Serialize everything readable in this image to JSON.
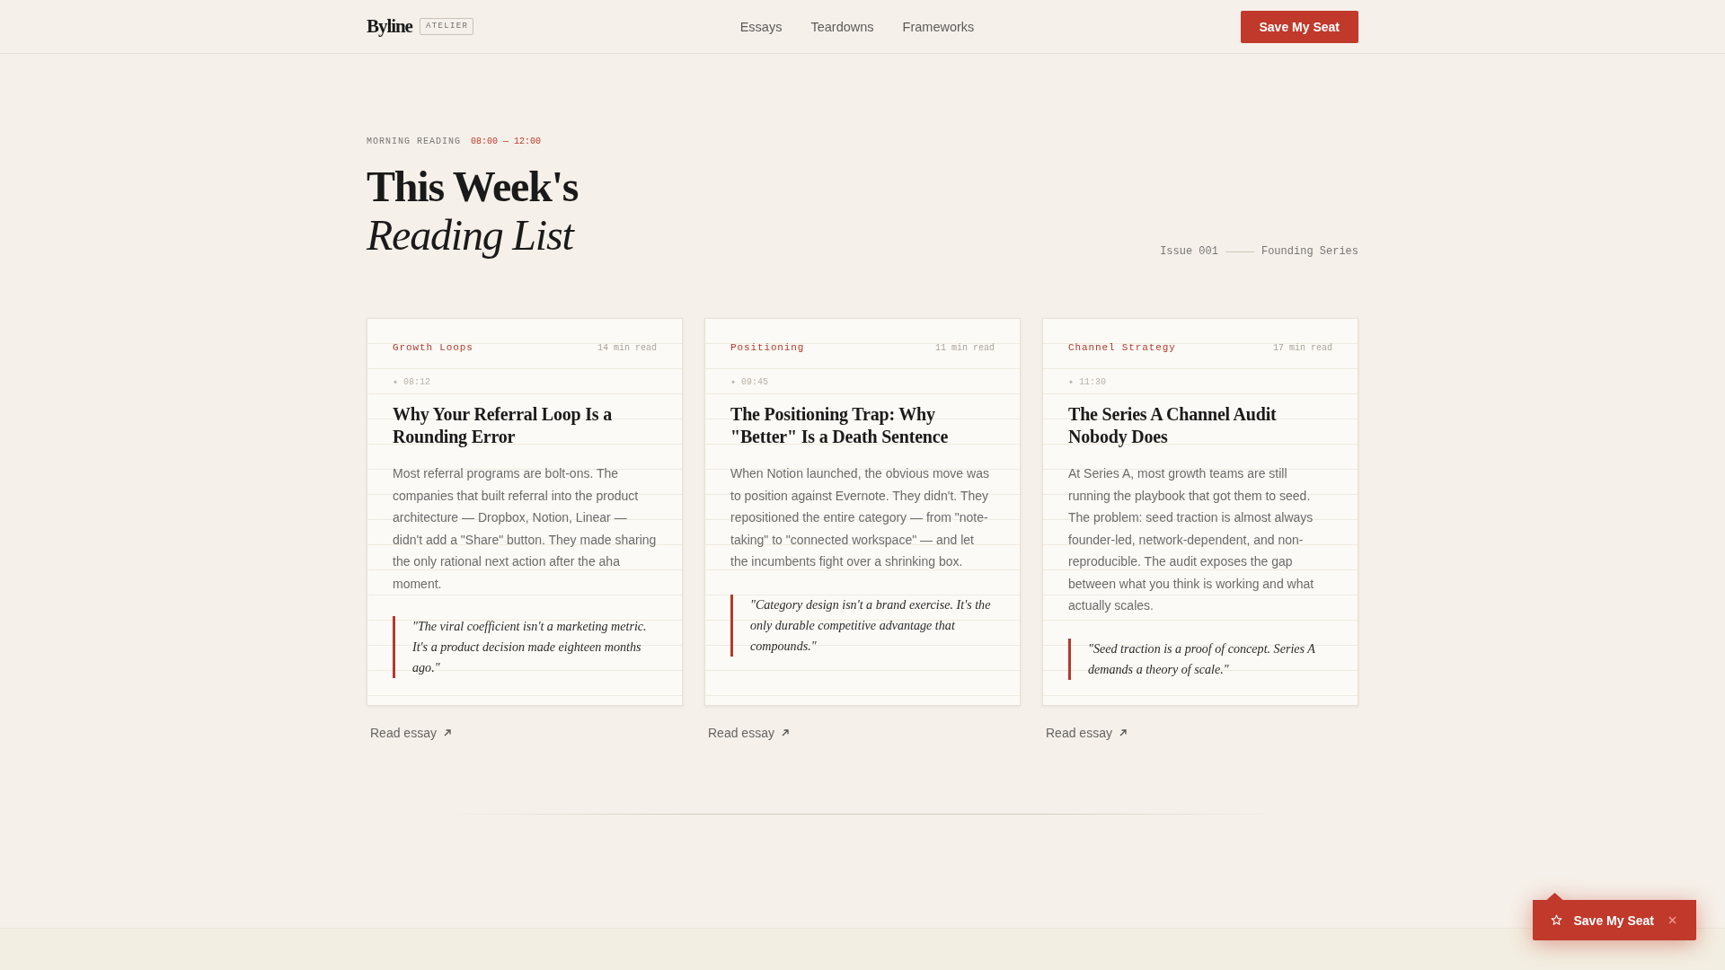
{
  "header": {
    "logo": "Byline",
    "brand_tag": "ATELIER",
    "nav": [
      {
        "label": "Essays"
      },
      {
        "label": "Teardowns"
      },
      {
        "label": "Frameworks"
      }
    ],
    "cta": "Save My Seat"
  },
  "hero": {
    "eyebrow": "MORNING READING",
    "time_range": "08:00 — 12:00",
    "title_lines": [
      {
        "text": "This Week's",
        "kind": "bold"
      },
      {
        "text": "Reading List",
        "kind": "italic"
      }
    ],
    "issue": "Issue 001",
    "series": "Founding Series"
  },
  "essays": [
    {
      "category": "Growth Loops",
      "read_time": "14 min read",
      "timestamp": "✦ 08:12",
      "title": "Why Your Referral Loop Is a Rounding Error",
      "excerpt": "Most referral programs are bolt-ons. The companies that built referral into the product architecture — Dropbox, Notion, Linear — didn't add a \"Share\" button. They made sharing the only rational next action after the aha moment.",
      "quote": "\"The viral coefficient isn't a marketing metric. It's a product decision made eighteen months ago.\"",
      "link": "Read essay"
    },
    {
      "category": "Positioning",
      "read_time": "11 min read",
      "timestamp": "✦ 09:45",
      "title": "The Positioning Trap: Why \"Better\" Is a Death Sentence",
      "excerpt": "When Notion launched, the obvious move was to position against Evernote. They didn't. They repositioned the entire category — from \"note-taking\" to \"connected workspace\" — and let the incumbents fight over a shrinking box.",
      "quote": "\"Category design isn't a brand exercise. It's the only durable competitive advantage that compounds.\"",
      "link": "Read essay"
    },
    {
      "category": "Channel Strategy",
      "read_time": "17 min read",
      "timestamp": "✦ 11:30",
      "title": "The Series A Channel Audit Nobody Does",
      "excerpt": "At Series A, most growth teams are still running the playbook that got them to seed. The problem: seed traction is almost always founder-led, network-dependent, and non-reproducible. The audit exposes the gap between what you think is working and what actually scales.",
      "quote": "\"Seed traction is a proof of concept. Series A demands a theory of scale.\"",
      "link": "Read essay"
    }
  ],
  "floating_cta": {
    "label": "Save My Seat"
  }
}
